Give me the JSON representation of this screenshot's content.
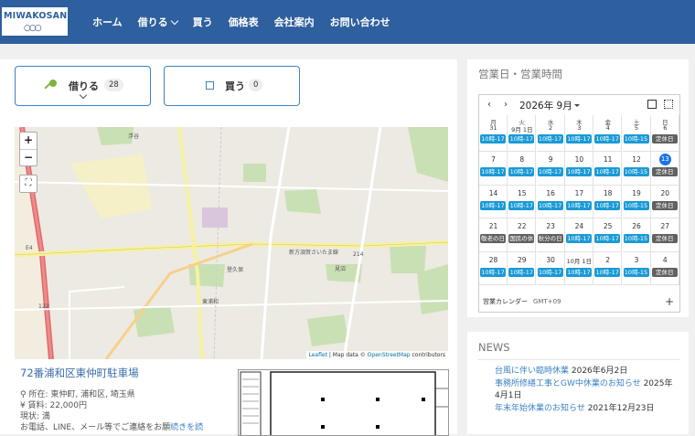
{
  "header": {
    "logo_text": "MIWAKOSAN",
    "nav": [
      "ホーム",
      "借りる",
      "買う",
      "価格表",
      "会社案内",
      "お問い合わせ"
    ]
  },
  "tabs": {
    "rent": {
      "label": "借りる",
      "count": "28"
    },
    "buy": {
      "label": "買う",
      "count": "0"
    }
  },
  "map": {
    "zoom_in": "+",
    "zoom_out": "−",
    "attribution_leaflet": "Leaflet",
    "attribution_sep": " | Map data © ",
    "attribution_osm": "OpenStreetMap",
    "attribution_end": " contributors",
    "labels": [
      "浮谷",
      "新方須賀さいたま線",
      "214",
      "登久保",
      "東浦和",
      "E4",
      "122",
      "見沼"
    ]
  },
  "property": {
    "title": "72番浦和区東仲町駐車場",
    "location": "所在: 東仲町, 浦和区, 埼玉県",
    "rent": "賃料: 22,000円",
    "status": "現状: 満",
    "contact": "お電話、LINE、メール等でご連絡をお願",
    "more": "続きを読"
  },
  "sidebar": {
    "hours_title": "営業日・営業時間",
    "calendar": {
      "month": "2026年 9月",
      "weekdays": [
        {
          "name": "月",
          "date": "31"
        },
        {
          "name": "火",
          "date": "9月 1日"
        },
        {
          "name": "水",
          "date": "2"
        },
        {
          "name": "木",
          "date": "3"
        },
        {
          "name": "金",
          "date": "4"
        },
        {
          "name": "土",
          "date": "5"
        },
        {
          "name": "日",
          "date": "6"
        }
      ],
      "rows": [
        {
          "days": [
            "7",
            "8",
            "9",
            "10",
            "11",
            "12",
            "13"
          ],
          "events": [
            "10時-17",
            "10時-17",
            "10時-17",
            "10時-17",
            "10時-17",
            "10時-15",
            "定休日"
          ]
        },
        {
          "days": [
            "14",
            "15",
            "16",
            "17",
            "18",
            "19",
            "20"
          ],
          "events": [
            "10時-17",
            "10時-17",
            "10時-17",
            "10時-17",
            "10時-17",
            "10時-15",
            "定休日"
          ]
        },
        {
          "days": [
            "21",
            "22",
            "23",
            "24",
            "25",
            "26",
            "27"
          ],
          "events": [
            "敬老の日",
            "国民の休",
            "秋分の日",
            "10時-17",
            "10時-17",
            "10時-15",
            "定休日"
          ]
        },
        {
          "days": [
            "28",
            "29",
            "30",
            "10月 1日",
            "2",
            "3",
            "4"
          ],
          "events": [
            "10時-17",
            "10時-17",
            "10時-17",
            "10時-17",
            "10時-17",
            "10時-15",
            "定休日"
          ]
        }
      ],
      "first_row_events": [
        "10時-17",
        "10時-17",
        "10時-17",
        "10時-17",
        "10時-17",
        "10時-15",
        "定休日"
      ],
      "today": "13",
      "footer": "営業カレンダー",
      "timezone": "GMT+09",
      "holiday_color": "#616161",
      "open_color": "#1a9ad6"
    },
    "news_title": "NEWS",
    "news": [
      {
        "link": "台風に伴い臨時休業",
        "date": " 2026年6月2日"
      },
      {
        "link": "事務所修繕工事とGW中休業のお知らせ",
        "date": " 2025年4月1日"
      },
      {
        "link": "年末年始休業のお知らせ",
        "date": " 2021年12月23日"
      }
    ]
  }
}
